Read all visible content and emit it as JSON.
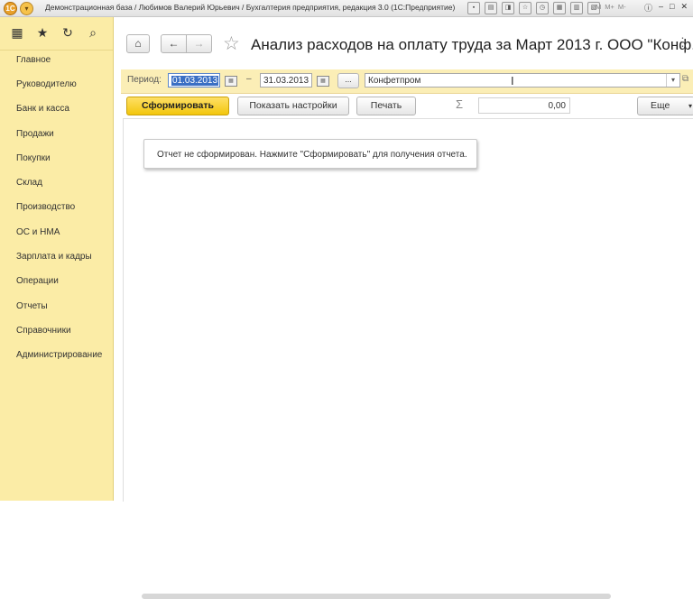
{
  "window": {
    "title": "Демонстрационная база / Любимов Валерий Юрьевич / Бухгалтерия предприятия, редакция 3.0  (1С:Предприятие)",
    "memory_buttons": [
      "M",
      "M+",
      "M-"
    ]
  },
  "sidebar": {
    "items": [
      {
        "label": "Главное"
      },
      {
        "label": "Руководителю"
      },
      {
        "label": "Банк и касса"
      },
      {
        "label": "Продажи"
      },
      {
        "label": "Покупки"
      },
      {
        "label": "Склад"
      },
      {
        "label": "Производство"
      },
      {
        "label": "ОС и НМА"
      },
      {
        "label": "Зарплата и кадры"
      },
      {
        "label": "Операции"
      },
      {
        "label": "Отчеты"
      },
      {
        "label": "Справочники"
      },
      {
        "label": "Администрирование"
      }
    ]
  },
  "header": {
    "title": "Анализ расходов на оплату труда за Март 2013 г. ООО \"Конф..."
  },
  "params": {
    "period_label": "Период:",
    "date_from": "01.03.2013",
    "dash": "–",
    "date_to": "31.03.2013",
    "dots": "...",
    "organization": "Конфетпром"
  },
  "toolbar": {
    "generate_label": "Сформировать",
    "settings_label": "Показать настройки",
    "print_label": "Печать",
    "sum_symbol": "Σ",
    "sum_value": "0,00",
    "more_label": "Еще"
  },
  "report": {
    "message": "Отчет не сформирован. Нажмите \"Сформировать\" для получения отчета."
  },
  "colors": {
    "sidebar_bg": "#fbeca6",
    "accent_button": "#f2c60d",
    "selection": "#3a6fc4"
  }
}
